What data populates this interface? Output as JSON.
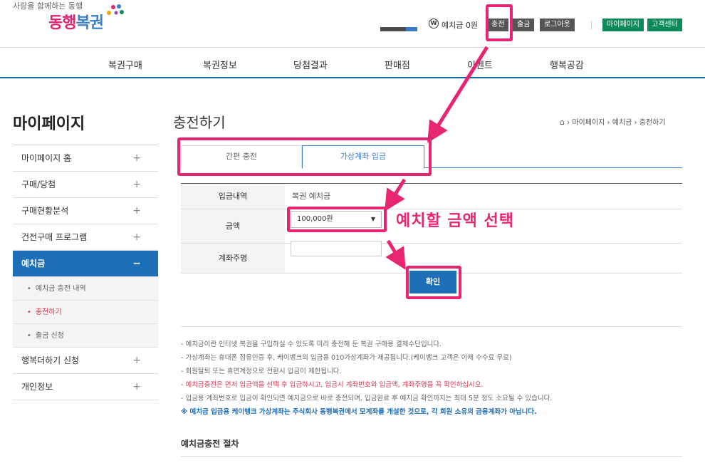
{
  "header": {
    "tagline": "사랑을 함께하는 동행",
    "logo_a": "동행",
    "logo_b": "복권",
    "deposit_label": "예치금 0원",
    "charge_label": "충전",
    "withdraw_label": "출금",
    "logout_label": "로그아웃",
    "mypage_label": "마이페이지",
    "cs_label": "고객센터"
  },
  "nav": [
    "복권구매",
    "복권정보",
    "당첨결과",
    "판매점",
    "이벤트",
    "행복공감"
  ],
  "sidebar": {
    "title": "마이페이지",
    "items": [
      {
        "label": "마이페이지 홈",
        "sign": "+"
      },
      {
        "label": "구매/당첨",
        "sign": "+"
      },
      {
        "label": "구매현황분석",
        "sign": "+"
      },
      {
        "label": "건전구매 프로그램",
        "sign": "+"
      },
      {
        "label": "예치금",
        "sign": "−"
      },
      {
        "label": "행복더하기 신청",
        "sign": "+"
      },
      {
        "label": "개인정보",
        "sign": "+"
      }
    ],
    "subitems": [
      {
        "label": "예치금 충전 내역"
      },
      {
        "label": "충전하기"
      },
      {
        "label": "출금 신청"
      }
    ]
  },
  "main": {
    "title": "충전하기",
    "breadcrumb": [
      "마이페이지",
      "예치금",
      "충전하기"
    ],
    "tabs": [
      "간편 충전",
      "가상계좌 입금"
    ],
    "form": {
      "rows": [
        {
          "label": "입금내역",
          "value": "복권 예치금"
        },
        {
          "label": "금액",
          "value": ""
        },
        {
          "label": "계좌주명",
          "value": ""
        }
      ],
      "amount_selected": "100,000원"
    },
    "confirm_label": "확인",
    "notes": [
      {
        "text": "- 예치금이란 인터넷 복권을 구입하실 수 있도록 미리 충전해 둔 복권 구매용 결제수단입니다.",
        "style": ""
      },
      {
        "text": "- 가상계좌는 휴대폰 점유인증 후, 케이뱅크의 입금용 010가상계좌가 제공됩니다.(케이뱅크 고객은 이체 수수료 무료)",
        "style": ""
      },
      {
        "text": "- 회원탈퇴 또는 휴면계정으로 전환시 입금이 제한됩니다.",
        "style": ""
      },
      {
        "text": "- 예치금충전은 먼저 입금액을 선택 후 입금하시고, 입금시 계좌번호와 입금액, 계좌주명을 꼭 확인하십시오.",
        "style": "red"
      },
      {
        "text": "- 입금용 계좌번호로 입금이 확인되면 예치금으로 바로 충전되며, 입금완료 후 예치금 확인까지는 최대 5분 정도 소요될 수 있습니다.",
        "style": ""
      },
      {
        "text": "※ 예치금 입금용 케이뱅크 가상계좌는 주식회사 동행복권에서 모계좌를 개설한 것으로, 각 회원 소유의 금융계좌가 아닙니다.",
        "style": "blue"
      }
    ],
    "procedure_title": "예치금충전 절차"
  },
  "annotation": {
    "text": "예치할 금액 선택",
    "color": "#e82570"
  }
}
